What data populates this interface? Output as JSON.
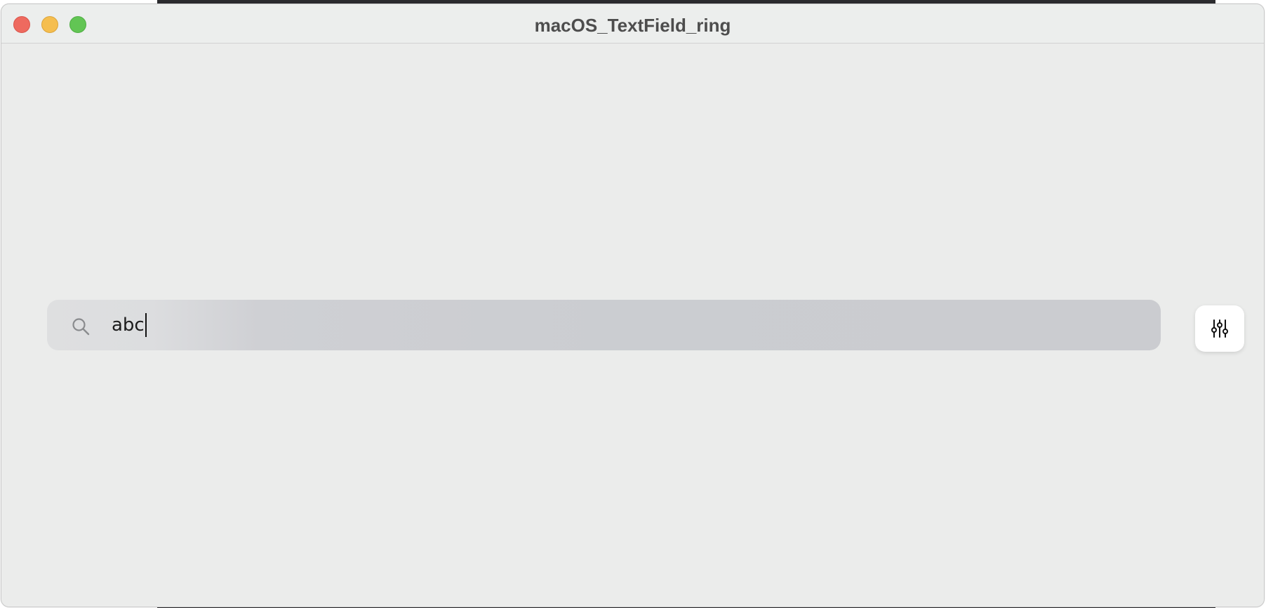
{
  "window": {
    "title": "macOS_TextField_ring",
    "buttons": {
      "close": "close-button",
      "minimize": "minimize-button",
      "maximize": "maximize-button"
    }
  },
  "search": {
    "value": "abc",
    "icon": "search-icon",
    "focused": true
  },
  "filter_button": {
    "icon": "sliders-icon"
  },
  "colors": {
    "close": "#ee6a5f",
    "minimize": "#f5be4f",
    "maximize": "#62c554",
    "window_bg": "#ebeceb",
    "title_text": "#4d4d4d",
    "field_bg": "#cbcdd1"
  }
}
